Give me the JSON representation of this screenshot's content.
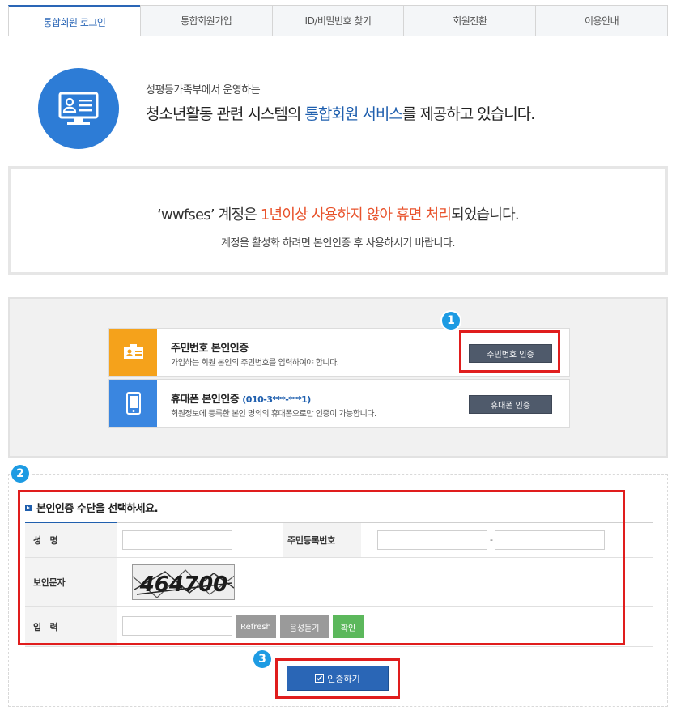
{
  "tabs": [
    {
      "label": "통합회원 로그인",
      "active": true
    },
    {
      "label": "통합회원가입"
    },
    {
      "label": "ID/비밀번호 찾기"
    },
    {
      "label": "회원전환"
    },
    {
      "label": "이용안내"
    }
  ],
  "intro": {
    "line1": "성평등가족부에서 운영하는",
    "line2_pre": "청소년활동 관련 시스템의 ",
    "line2_hl": "통합회원 서비스",
    "line2_post": "를 제공하고 있습니다.",
    "icon": "id-card-monitor-icon"
  },
  "notice": {
    "line1_pre": "‘wwfses’ 계정은 ",
    "line1_red": "1년이상 사용하지 않아 휴면 처리",
    "line1_post": "되었습니다.",
    "line2": "계정을 활성화 하려면 본인인증 후 사용하시기 바랍니다."
  },
  "auth_methods": [
    {
      "title": "주민번호 본인인증",
      "sub": "",
      "desc": "가입하는 회원 본인의 주민번호를 입력하여야 합니다.",
      "button": "주민번호 인증",
      "icon": "id-card-icon",
      "color": "#f5a21b"
    },
    {
      "title": "휴대폰 본인인증 ",
      "sub": "(010-3***-***1)",
      "desc": "회원정보에 등록한 본인 명의의 휴대폰으로만 인증이 가능합니다.",
      "button": "휴대폰 인증",
      "icon": "mobile-phone-icon",
      "color": "#3a86e0"
    }
  ],
  "callouts": [
    "1",
    "2",
    "3"
  ],
  "form": {
    "title": "본인인증 수단을 선택하세요.",
    "name_label": "성　명",
    "rrn_label": "주민등록번호",
    "dash": "-",
    "captcha_label": "보안문자",
    "captcha_text": "464700",
    "input_label": "입　력",
    "refresh": "Refresh",
    "audio": "음성듣기",
    "confirm": "확인"
  },
  "submit_label": "인증하기",
  "colors": {
    "accent": "#2a66b6",
    "orange": "#f5a21b",
    "red_notice": "#e8522b",
    "highlight_box": "#e01d1d",
    "callout": "#1d9be3",
    "confirm_green": "#5cb85c"
  }
}
